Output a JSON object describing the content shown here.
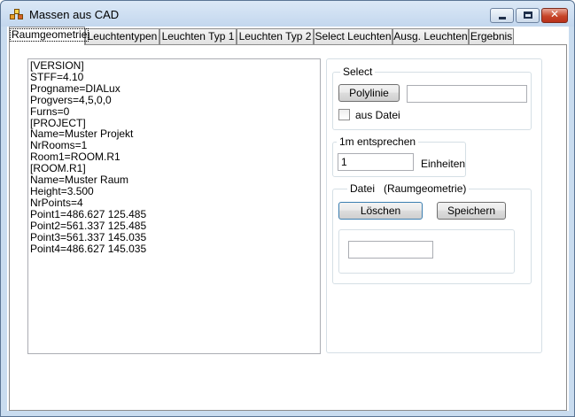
{
  "window": {
    "title": "Massen aus CAD",
    "icon": "app-icon",
    "controls": {
      "minimize": "minimize-icon",
      "maximize": "maximize-icon",
      "close": "close-icon"
    },
    "colors": {
      "titlebar": "#c9dcef",
      "close": "#c74528"
    }
  },
  "tabs": [
    {
      "label": "Raumgeometrie",
      "active": true
    },
    {
      "label": "Leuchtentypen"
    },
    {
      "label": "Leuchten Typ 1"
    },
    {
      "label": "Leuchten Typ 2"
    },
    {
      "label": "Select Leuchten"
    },
    {
      "label": "Ausg. Leuchten"
    },
    {
      "label": "Ergebnis"
    }
  ],
  "geometry_text": "[VERSION]\nSTFF=4.10\nProgname=DIALux\nProgvers=4,5,0,0\nFurns=0\n[PROJECT]\nName=Muster Projekt\nNrRooms=1\nRoom1=ROOM.R1\n[ROOM.R1]\nName=Muster Raum\nHeight=3.500\nNrPoints=4\nPoint1=486.627 125.485\nPoint2=561.337 125.485\nPoint3=561.337 145.035\nPoint4=486.627 145.035",
  "select_group": {
    "legend": "Select",
    "polyline_button": "Polylinie",
    "polyline_value": "",
    "from_file_label": "aus Datei",
    "from_file_checked": false
  },
  "scale_group": {
    "legend": "1m entsprechen",
    "value": "1",
    "unit_label": "Einheiten"
  },
  "file_group": {
    "legend": "Datei   (Raumgeometrie)",
    "delete_button": "Löschen",
    "save_button": "Speichern",
    "inner_value": ""
  }
}
